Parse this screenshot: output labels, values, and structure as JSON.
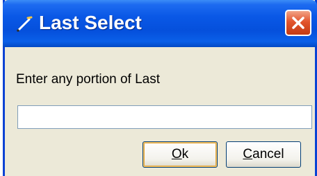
{
  "window": {
    "title": "Last Select",
    "title_icon": "pencil-icon",
    "close_icon": "close-icon"
  },
  "dialog": {
    "prompt": "Enter any portion of Last",
    "input_value": ""
  },
  "buttons": {
    "ok": {
      "mnemonic": "O",
      "rest": "k"
    },
    "cancel": {
      "mnemonic": "C",
      "rest": "ancel"
    }
  },
  "colors": {
    "titlebar": "#0550dc",
    "close": "#e2552d",
    "background": "#ece9d8"
  }
}
